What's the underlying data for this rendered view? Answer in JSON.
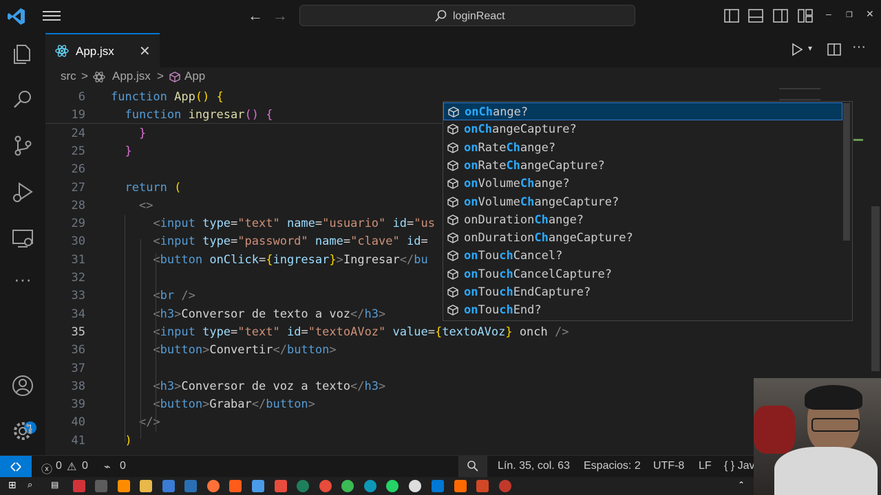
{
  "titlebar": {
    "search_label": "loginReact"
  },
  "tab": {
    "filename": "App.jsx"
  },
  "breadcrumb": {
    "folder": "src",
    "file": "App.jsx",
    "symbol": "App",
    "sep": ">"
  },
  "editor": {
    "lines": [
      {
        "num": "6",
        "tokens": [
          [
            "kw",
            "function "
          ],
          [
            "fn",
            "App"
          ],
          [
            "br1",
            "() {"
          ]
        ]
      },
      {
        "num": "19",
        "tokens": [
          [
            "txt",
            "  "
          ],
          [
            "kw",
            "function "
          ],
          [
            "fn",
            "ingresar"
          ],
          [
            "br2",
            "() {"
          ]
        ]
      },
      {
        "num": "24",
        "tokens": [
          [
            "txt",
            "    "
          ],
          [
            "br2",
            "}"
          ]
        ]
      },
      {
        "num": "25",
        "tokens": [
          [
            "txt",
            "  "
          ],
          [
            "br2",
            "}"
          ]
        ]
      },
      {
        "num": "26",
        "tokens": []
      },
      {
        "num": "27",
        "tokens": [
          [
            "txt",
            "  "
          ],
          [
            "kw",
            "return "
          ],
          [
            "br1",
            "("
          ]
        ]
      },
      {
        "num": "28",
        "tokens": [
          [
            "txt",
            "    "
          ],
          [
            "tag",
            "<>"
          ]
        ]
      },
      {
        "num": "29",
        "tokens": [
          [
            "txt",
            "      "
          ],
          [
            "tag",
            "<"
          ],
          [
            "tn",
            "input "
          ],
          [
            "attr",
            "type"
          ],
          [
            "txt",
            "="
          ],
          [
            "str",
            "\"text\" "
          ],
          [
            "attr",
            "name"
          ],
          [
            "txt",
            "="
          ],
          [
            "str",
            "\"usuario\" "
          ],
          [
            "attr",
            "id"
          ],
          [
            "txt",
            "="
          ],
          [
            "str",
            "\"us"
          ]
        ]
      },
      {
        "num": "30",
        "tokens": [
          [
            "txt",
            "      "
          ],
          [
            "tag",
            "<"
          ],
          [
            "tn",
            "input "
          ],
          [
            "attr",
            "type"
          ],
          [
            "txt",
            "="
          ],
          [
            "str",
            "\"password\" "
          ],
          [
            "attr",
            "name"
          ],
          [
            "txt",
            "="
          ],
          [
            "str",
            "\"clave\" "
          ],
          [
            "attr",
            "id"
          ],
          [
            "txt",
            "="
          ]
        ]
      },
      {
        "num": "31",
        "tokens": [
          [
            "txt",
            "      "
          ],
          [
            "tag",
            "<"
          ],
          [
            "tn",
            "button "
          ],
          [
            "attr",
            "onClick"
          ],
          [
            "txt",
            "="
          ],
          [
            "br1",
            "{"
          ],
          [
            "attr",
            "ingresar"
          ],
          [
            "br1",
            "}"
          ],
          [
            "tag",
            ">"
          ],
          [
            "txt",
            "Ingresar"
          ],
          [
            "tag",
            "</"
          ],
          [
            "tn",
            "bu"
          ]
        ]
      },
      {
        "num": "32",
        "tokens": []
      },
      {
        "num": "33",
        "tokens": [
          [
            "txt",
            "      "
          ],
          [
            "tag",
            "<"
          ],
          [
            "tn",
            "br "
          ],
          [
            "tag",
            "/>"
          ]
        ]
      },
      {
        "num": "34",
        "tokens": [
          [
            "txt",
            "      "
          ],
          [
            "tag",
            "<"
          ],
          [
            "tn",
            "h3"
          ],
          [
            "tag",
            ">"
          ],
          [
            "txt",
            "Conversor de texto a voz"
          ],
          [
            "tag",
            "</"
          ],
          [
            "tn",
            "h3"
          ],
          [
            "tag",
            ">"
          ]
        ]
      },
      {
        "num": "35",
        "tokens": [
          [
            "txt",
            "      "
          ],
          [
            "tag",
            "<"
          ],
          [
            "tn",
            "input "
          ],
          [
            "attr",
            "type"
          ],
          [
            "txt",
            "="
          ],
          [
            "str",
            "\"text\" "
          ],
          [
            "attr",
            "id"
          ],
          [
            "txt",
            "="
          ],
          [
            "str",
            "\"textoAVoz\" "
          ],
          [
            "attr",
            "value"
          ],
          [
            "txt",
            "="
          ],
          [
            "br1",
            "{"
          ],
          [
            "attr",
            "textoAVoz"
          ],
          [
            "br1",
            "}"
          ],
          [
            "txt",
            " onch "
          ],
          [
            "tag",
            "/>"
          ]
        ]
      },
      {
        "num": "36",
        "tokens": [
          [
            "txt",
            "      "
          ],
          [
            "tag",
            "<"
          ],
          [
            "tn",
            "button"
          ],
          [
            "tag",
            ">"
          ],
          [
            "txt",
            "Convertir"
          ],
          [
            "tag",
            "</"
          ],
          [
            "tn",
            "button"
          ],
          [
            "tag",
            ">"
          ]
        ]
      },
      {
        "num": "37",
        "tokens": []
      },
      {
        "num": "38",
        "tokens": [
          [
            "txt",
            "      "
          ],
          [
            "tag",
            "<"
          ],
          [
            "tn",
            "h3"
          ],
          [
            "tag",
            ">"
          ],
          [
            "txt",
            "Conversor de voz a texto"
          ],
          [
            "tag",
            "</"
          ],
          [
            "tn",
            "h3"
          ],
          [
            "tag",
            ">"
          ]
        ]
      },
      {
        "num": "39",
        "tokens": [
          [
            "txt",
            "      "
          ],
          [
            "tag",
            "<"
          ],
          [
            "tn",
            "button"
          ],
          [
            "tag",
            ">"
          ],
          [
            "txt",
            "Grabar"
          ],
          [
            "tag",
            "</"
          ],
          [
            "tn",
            "button"
          ],
          [
            "tag",
            ">"
          ]
        ]
      },
      {
        "num": "40",
        "tokens": [
          [
            "txt",
            "    "
          ],
          [
            "tag",
            "</>"
          ]
        ]
      },
      {
        "num": "41",
        "tokens": [
          [
            "txt",
            "  "
          ],
          [
            "br1",
            ")"
          ]
        ]
      }
    ],
    "current_line": "35"
  },
  "suggest": {
    "items": [
      {
        "hl": "onCh",
        "rest": "ange?"
      },
      {
        "hl": "onCh",
        "rest": "angeCapture?"
      },
      {
        "pre": "on",
        "mid": "Rate",
        "hl": "Ch",
        "rest": "ange?"
      },
      {
        "pre": "on",
        "mid": "Rate",
        "hl": "Ch",
        "rest": "angeCapture?"
      },
      {
        "pre": "on",
        "mid": "Volume",
        "hl": "Ch",
        "rest": "ange?"
      },
      {
        "pre": "on",
        "mid": "Volume",
        "hl": "Ch",
        "rest": "angeCapture?"
      },
      {
        "pre": "on",
        "mid": "Duration",
        "hl": "Ch",
        "rest": "ange?",
        "plain": true
      },
      {
        "pre": "on",
        "mid": "Duration",
        "hl": "Ch",
        "rest": "angeCapture?",
        "plain": true
      },
      {
        "pre": "on",
        "mid": "Tou",
        "hl": "ch",
        "rest": "Cancel?"
      },
      {
        "pre": "on",
        "mid": "Tou",
        "hl": "ch",
        "rest": "CancelCapture?"
      },
      {
        "pre": "on",
        "mid": "Tou",
        "hl": "ch",
        "rest": "EndCapture?"
      },
      {
        "pre": "on",
        "mid": "Tou",
        "hl": "ch",
        "rest": "End?"
      }
    ]
  },
  "status": {
    "errors": "0",
    "warnings": "0",
    "ports": "0",
    "position": "Lín. 35, col. 63",
    "spaces": "Espacios: 2",
    "encoding": "UTF-8",
    "eol": "LF",
    "language": "{ } Jav"
  },
  "activity": {
    "accounts_badge": "1"
  },
  "colors": {
    "accent": "#0078d4",
    "selection": "#04395e",
    "match": "#2aaaff"
  }
}
